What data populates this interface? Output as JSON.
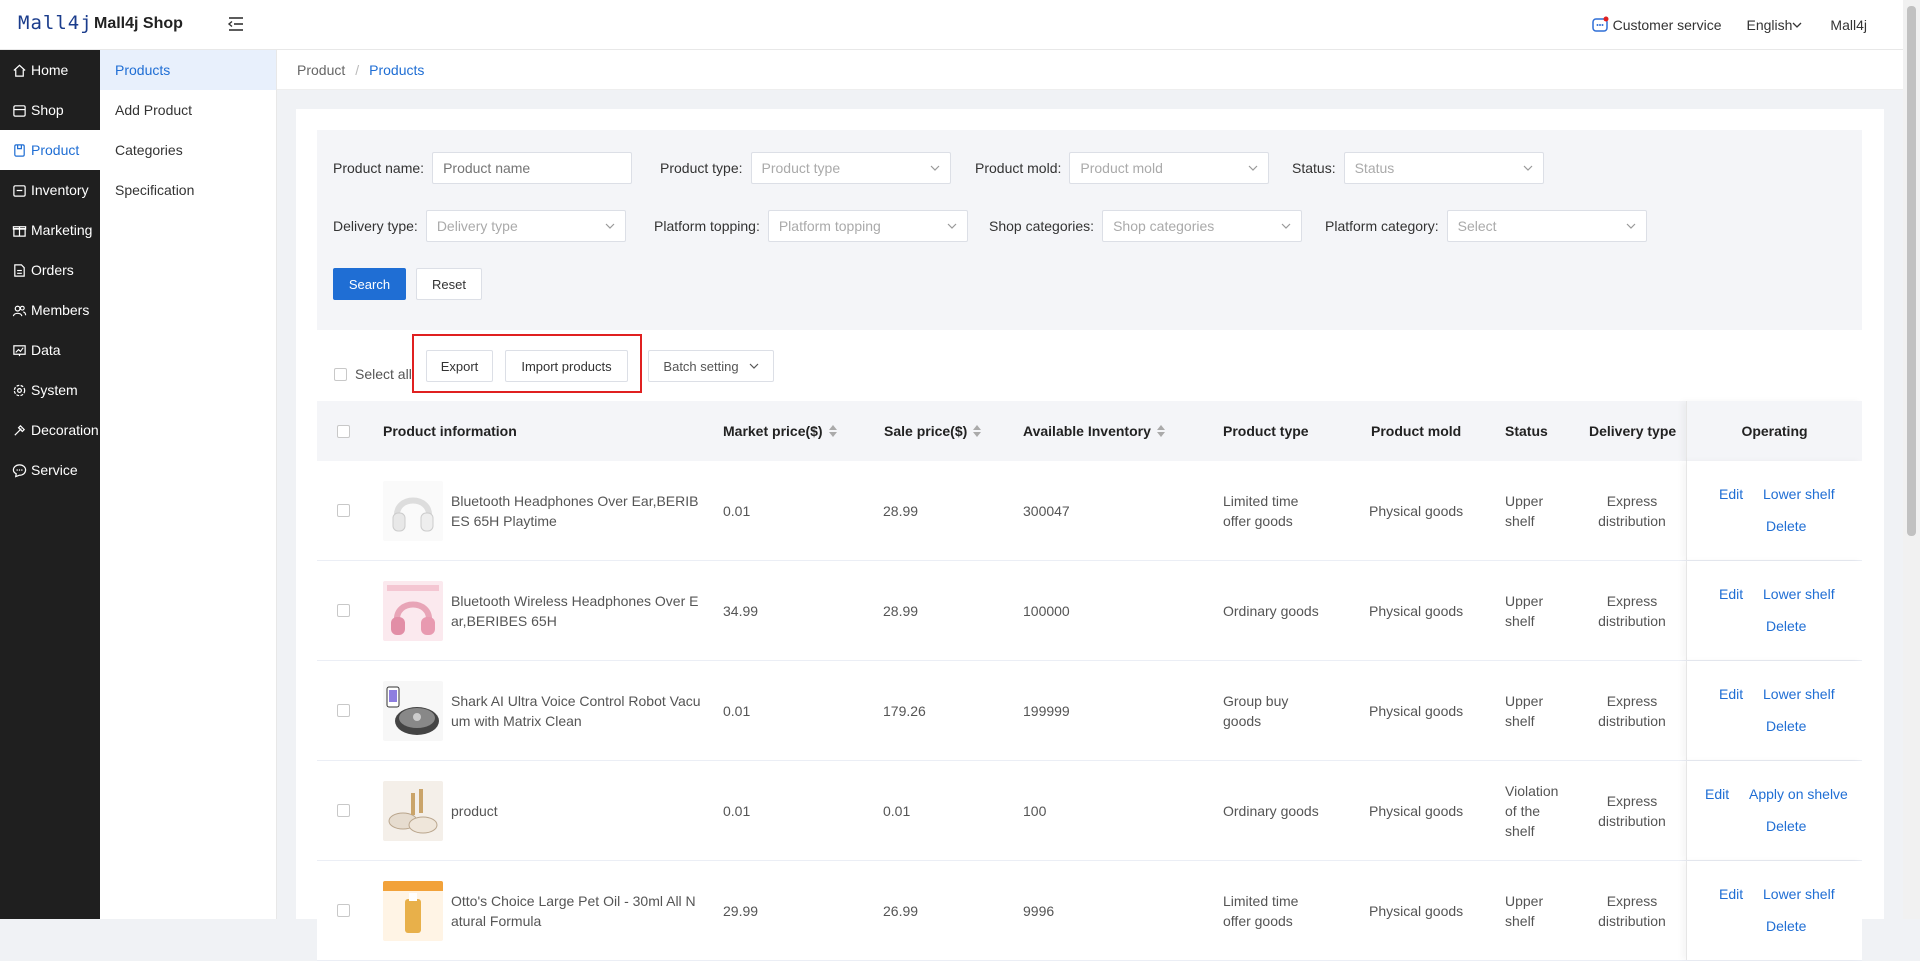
{
  "header": {
    "logo_mark": "Mall4j",
    "logo_text": "Mall4j Shop",
    "customer_service": "Customer service",
    "language": "English",
    "user": "Mall4j"
  },
  "sidebar": {
    "items": [
      {
        "label": "Home",
        "icon": "home-icon"
      },
      {
        "label": "Shop",
        "icon": "shop-icon"
      },
      {
        "label": "Product",
        "icon": "product-icon",
        "active": true
      },
      {
        "label": "Inventory",
        "icon": "inventory-icon"
      },
      {
        "label": "Marketing",
        "icon": "gift-icon"
      },
      {
        "label": "Orders",
        "icon": "orders-icon"
      },
      {
        "label": "Members",
        "icon": "members-icon"
      },
      {
        "label": "Data",
        "icon": "data-icon"
      },
      {
        "label": "System",
        "icon": "gear-icon"
      },
      {
        "label": "Decoration",
        "icon": "decoration-icon"
      },
      {
        "label": "Service",
        "icon": "chat-icon"
      }
    ]
  },
  "submenu": {
    "items": [
      {
        "label": "Products",
        "active": true
      },
      {
        "label": "Add Product"
      },
      {
        "label": "Categories"
      },
      {
        "label": "Specification"
      }
    ]
  },
  "breadcrumb": {
    "parent": "Product",
    "sep": "/",
    "current": "Products"
  },
  "filters": {
    "product_name": {
      "label": "Product name:",
      "placeholder": "Product name"
    },
    "product_type": {
      "label": "Product type:",
      "placeholder": "Product type"
    },
    "product_mold": {
      "label": "Product mold:",
      "placeholder": "Product mold"
    },
    "status": {
      "label": "Status:",
      "placeholder": "Status"
    },
    "delivery_type": {
      "label": "Delivery type:",
      "placeholder": "Delivery type"
    },
    "platform_topping": {
      "label": "Platform topping:",
      "placeholder": "Platform topping"
    },
    "shop_categories": {
      "label": "Shop categories:",
      "placeholder": "Shop categories"
    },
    "platform_category": {
      "label": "Platform category:",
      "placeholder": "Select"
    },
    "search_label": "Search",
    "reset_label": "Reset"
  },
  "toolbar": {
    "select_all": "Select all",
    "export": "Export",
    "import": "Import products",
    "batch": "Batch setting"
  },
  "table": {
    "columns": {
      "info": "Product information",
      "market": "Market price($)",
      "sale": "Sale price($)",
      "inventory": "Available Inventory",
      "type": "Product type",
      "mold": "Product mold",
      "status": "Status",
      "delivery": "Delivery type",
      "operating": "Operating"
    },
    "rows": [
      {
        "name": "Bluetooth Headphones Over Ear,BERIBES 65H Playtime",
        "market": "0.01",
        "sale": "28.99",
        "inventory": "300047",
        "type_l1": "Limited time",
        "type_l2": "offer goods",
        "mold": "Physical goods",
        "status_l1": "Upper",
        "status_l2": "shelf",
        "status_l3": "",
        "delivery_l1": "Express",
        "delivery_l2": "distribution",
        "op_edit": "Edit",
        "op_shelf": "Lower shelf",
        "op_delete": "Delete",
        "thumb": "white-headphones"
      },
      {
        "name": "Bluetooth Wireless Headphones Over Ear,BERIBES 65H",
        "market": "34.99",
        "sale": "28.99",
        "inventory": "100000",
        "type_l1": "Ordinary goods",
        "type_l2": "",
        "mold": "Physical goods",
        "status_l1": "Upper",
        "status_l2": "shelf",
        "status_l3": "",
        "delivery_l1": "Express",
        "delivery_l2": "distribution",
        "op_edit": "Edit",
        "op_shelf": "Lower shelf",
        "op_delete": "Delete",
        "thumb": "pink-headphones"
      },
      {
        "name": "Shark AI Ultra Voice Control Robot Vacuum with Matrix Clean",
        "market": "0.01",
        "sale": "179.26",
        "inventory": "199999",
        "type_l1": "Group buy",
        "type_l2": "goods",
        "mold": "Physical goods",
        "status_l1": "Upper",
        "status_l2": "shelf",
        "status_l3": "",
        "delivery_l1": "Express",
        "delivery_l2": "distribution",
        "op_edit": "Edit",
        "op_shelf": "Lower shelf",
        "op_delete": "Delete",
        "thumb": "robot-vacuum"
      },
      {
        "name": "product",
        "market": "0.01",
        "sale": "0.01",
        "inventory": "100",
        "type_l1": "Ordinary goods",
        "type_l2": "",
        "mold": "Physical goods",
        "status_l1": "Violation",
        "status_l2": "of the",
        "status_l3": "shelf",
        "delivery_l1": "Express",
        "delivery_l2": "distribution",
        "op_edit": "Edit",
        "op_shelf": "Apply on shelve",
        "op_delete": "Delete",
        "thumb": "cookware"
      },
      {
        "name": "Otto's Choice Large Pet Oil - 30ml All Natural Formula",
        "market": "29.99",
        "sale": "26.99",
        "inventory": "9996",
        "type_l1": "Limited time",
        "type_l2": "offer goods",
        "mold": "Physical goods",
        "status_l1": "Upper",
        "status_l2": "shelf",
        "status_l3": "",
        "delivery_l1": "Express",
        "delivery_l2": "distribution",
        "op_edit": "Edit",
        "op_shelf": "Lower shelf",
        "op_delete": "Delete",
        "thumb": "pet-oil"
      }
    ]
  }
}
